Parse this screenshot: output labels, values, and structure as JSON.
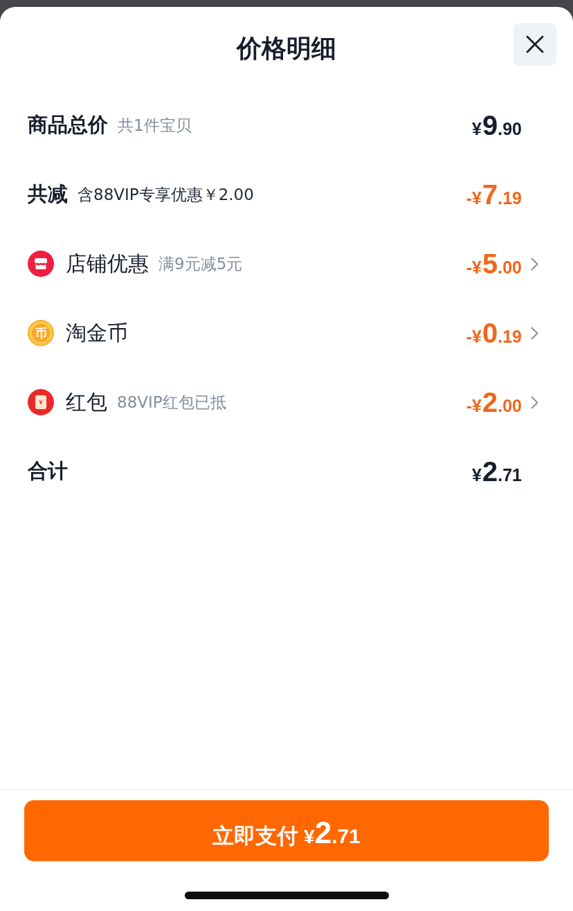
{
  "sheet": {
    "title": "价格明细"
  },
  "rows": [
    {
      "kind": "subtotal",
      "label": "商品总价",
      "note": "共1件宝贝",
      "amount": {
        "prefix": "¥",
        "integer": "9",
        "fraction": ".90"
      },
      "navigable": false
    },
    {
      "kind": "savings",
      "label": "共减",
      "note": "含88VIP专享优惠￥2.00",
      "amount": {
        "prefix": "-¥",
        "integer": "7",
        "fraction": ".19"
      },
      "navigable": false
    },
    {
      "kind": "shop",
      "label": "店铺优惠",
      "note": "满9元减5元",
      "amount": {
        "prefix": "-¥",
        "integer": "5",
        "fraction": ".00"
      },
      "navigable": true
    },
    {
      "kind": "coin",
      "badge": "币",
      "label": "淘金币",
      "amount": {
        "prefix": "-¥",
        "integer": "0",
        "fraction": ".19"
      },
      "navigable": true
    },
    {
      "kind": "hongbao",
      "badge": "¥",
      "label": "红包",
      "note": "88VIP红包已抵",
      "amount": {
        "prefix": "-¥",
        "integer": "2",
        "fraction": ".00"
      },
      "navigable": true
    },
    {
      "kind": "total",
      "label": "合计",
      "amount": {
        "prefix": "¥",
        "integer": "2",
        "fraction": ".71"
      },
      "navigable": false
    }
  ],
  "pay_button": {
    "label": "立即支付",
    "amount": {
      "prefix": "¥",
      "integer": "2",
      "fraction": ".71"
    }
  }
}
